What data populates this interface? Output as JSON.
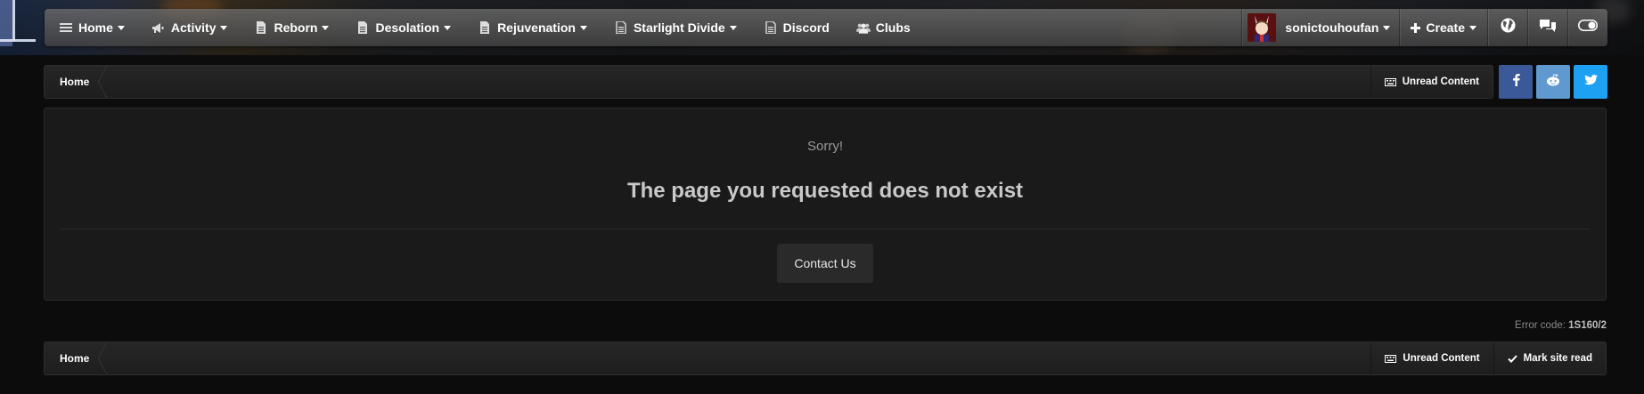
{
  "nav": {
    "items": [
      {
        "label": "Home",
        "icon": "list-icon"
      },
      {
        "label": "Activity",
        "icon": "megaphone-icon"
      },
      {
        "label": "Reborn",
        "icon": "document-icon"
      },
      {
        "label": "Desolation",
        "icon": "document-icon"
      },
      {
        "label": "Rejuvenation",
        "icon": "document-icon"
      },
      {
        "label": "Starlight Divide",
        "icon": "document-icon"
      },
      {
        "label": "Discord",
        "icon": "document-icon"
      },
      {
        "label": "Clubs",
        "icon": "users-icon"
      }
    ],
    "username": "sonictouhoufan",
    "create_label": "Create"
  },
  "breadcrumb": {
    "home_label": "Home",
    "unread_label": "Unread Content",
    "mark_read_label": "Mark site read"
  },
  "social": {
    "facebook": "#3b5998",
    "reddit": "#5f99cf",
    "twitter": "#1da1f2"
  },
  "error": {
    "sorry": "Sorry!",
    "title": "The page you requested does not exist",
    "contact_label": "Contact Us",
    "code_prefix": "Error code:",
    "code": "1S160/2"
  }
}
